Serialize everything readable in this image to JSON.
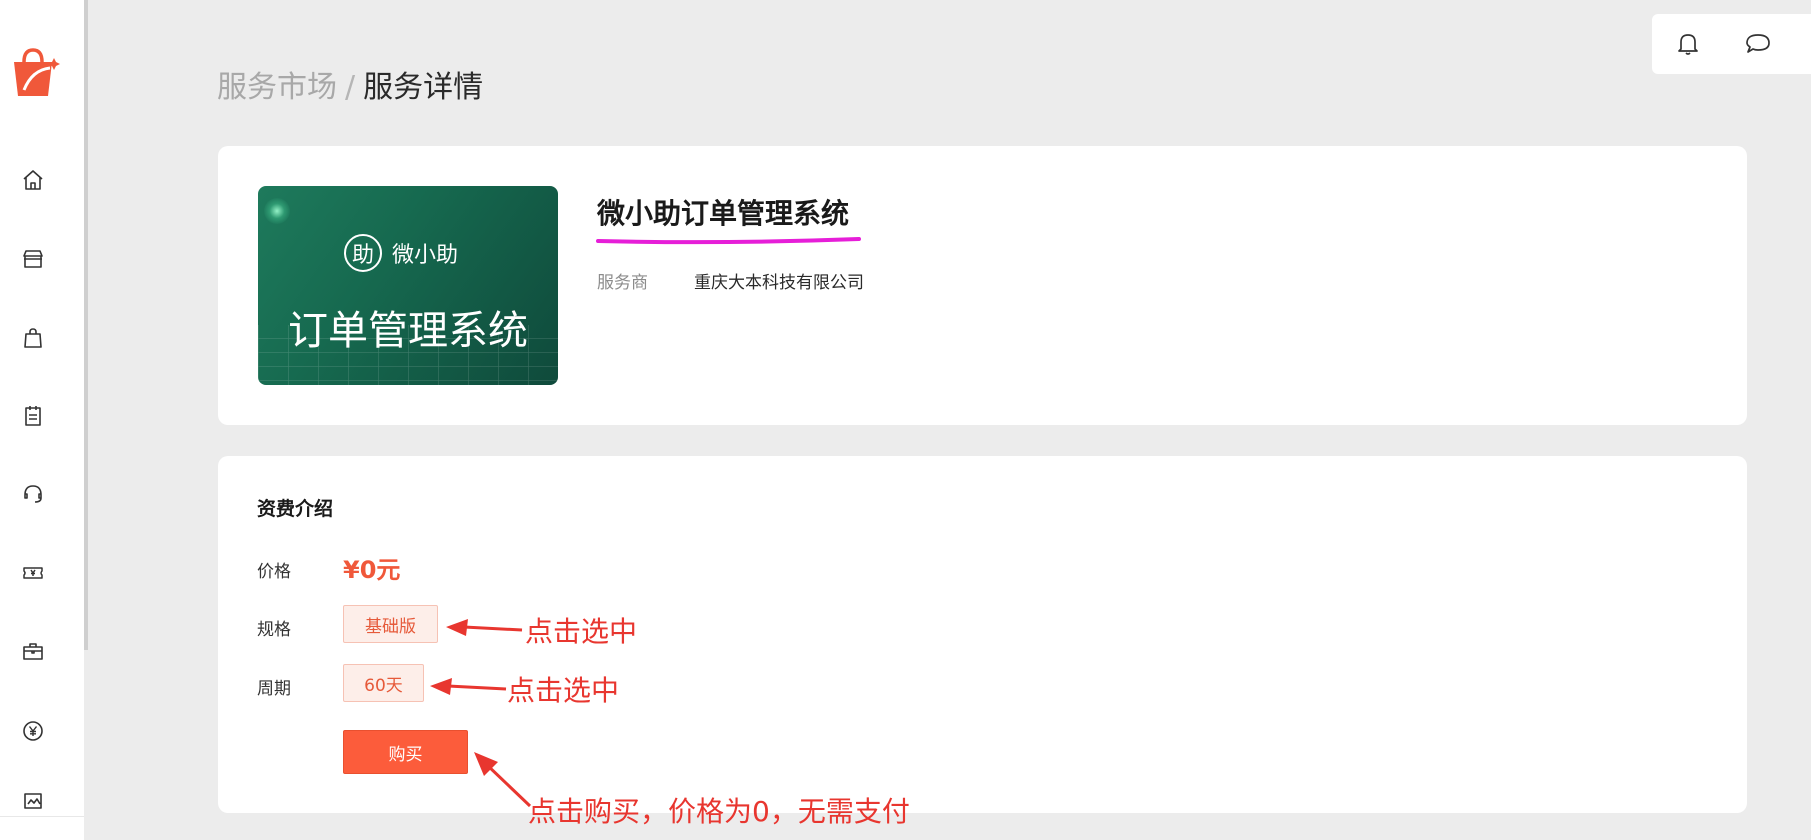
{
  "breadcrumb": {
    "parent": "服务市场",
    "separator": "/",
    "current": "服务详情"
  },
  "sidebar": {
    "logo_icon": "shopping-bag-logo-icon",
    "items": [
      {
        "icon": "home-icon"
      },
      {
        "icon": "store-icon"
      },
      {
        "icon": "shopping-bag-icon"
      },
      {
        "icon": "clipboard-icon"
      },
      {
        "icon": "headset-icon"
      },
      {
        "icon": "ticket-icon"
      },
      {
        "icon": "briefcase-icon"
      },
      {
        "icon": "yen-icon"
      },
      {
        "icon": "image-icon"
      }
    ]
  },
  "top_actions": {
    "icons": [
      "bell-icon",
      "chat-bubble-icon"
    ]
  },
  "product": {
    "name": "微小助订单管理系统",
    "vendor_label": "服务商",
    "vendor": "重庆大本科技有限公司",
    "thumbnail": {
      "brand_mark": "助",
      "brand_name": "微小助",
      "title": "订单管理系统"
    }
  },
  "pricing": {
    "section_title": "资费介绍",
    "price_label": "价格",
    "price_value": "¥0元",
    "spec_label": "规格",
    "spec_option": "基础版",
    "period_label": "周期",
    "period_option": "60天",
    "buy_label": "购买"
  },
  "annotations": {
    "spec_note": "点击选中",
    "period_note": "点击选中",
    "buy_note": "点击购买，价格为0，无需支付"
  },
  "colors": {
    "accent": "#fc5c3b",
    "price": "#f0583a",
    "annotation": "#e8362f",
    "highlight": "#e61ed8",
    "background": "#ececec"
  }
}
